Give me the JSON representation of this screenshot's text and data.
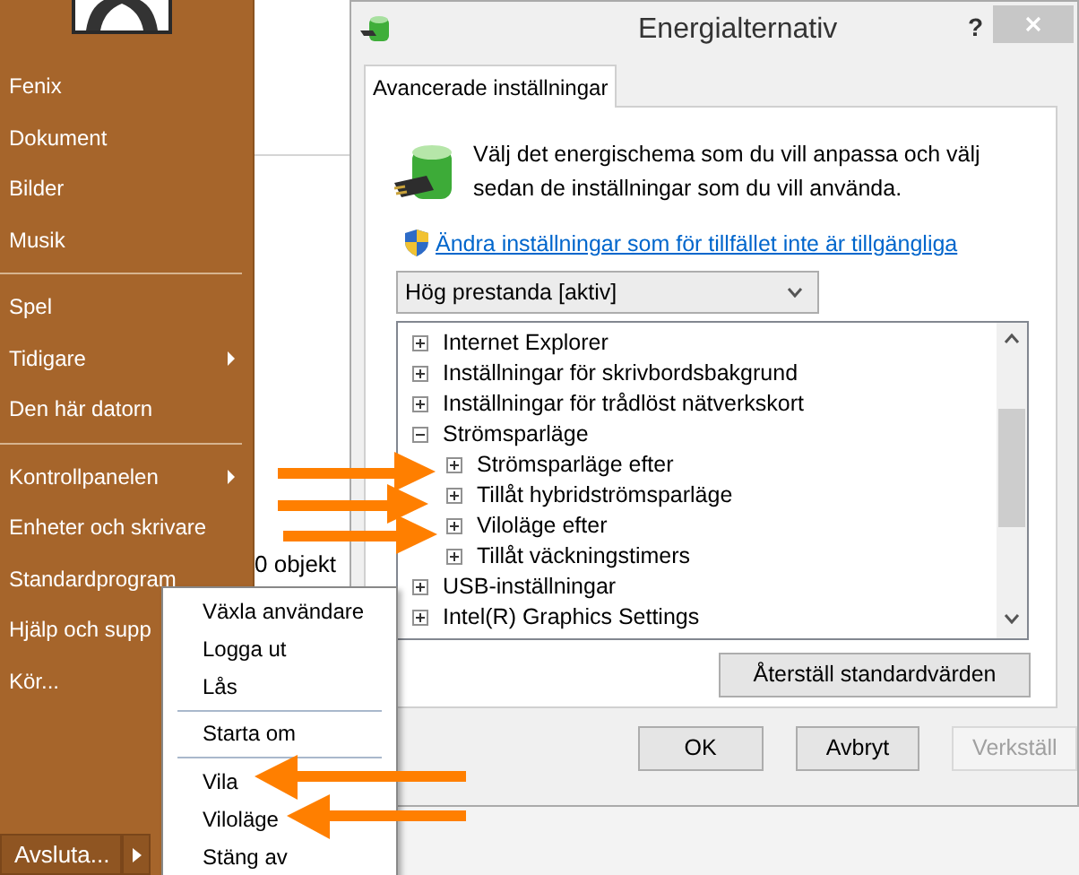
{
  "start_menu": {
    "groups": [
      [
        {
          "label": "Fenix",
          "submenu": false
        },
        {
          "label": "Dokument",
          "submenu": false
        },
        {
          "label": "Bilder",
          "submenu": false
        },
        {
          "label": "Musik",
          "submenu": false
        }
      ],
      [
        {
          "label": "Spel",
          "submenu": false
        },
        {
          "label": "Tidigare",
          "submenu": true
        },
        {
          "label": "Den här datorn",
          "submenu": false
        }
      ],
      [
        {
          "label": "Kontrollpanelen",
          "submenu": true
        },
        {
          "label": "Enheter och skrivare",
          "submenu": false
        },
        {
          "label": "Standardprogram",
          "submenu": false
        },
        {
          "label": "Hjälp och supp"
        },
        {
          "label": "Kör..."
        }
      ]
    ],
    "shutdown_button": "Avsluta..."
  },
  "power_menu": {
    "groups": [
      [
        "Växla användare",
        "Logga ut",
        "Lås"
      ],
      [
        "Starta om"
      ],
      [
        "Vila",
        "Viloläge",
        "Stäng av"
      ]
    ]
  },
  "background_window": {
    "status": "0 objekt"
  },
  "dialog": {
    "title": "Energialternativ",
    "help": "?",
    "tabs": [
      {
        "label": "Avancerade inställningar",
        "selected": true
      }
    ],
    "description": "Välj det energischema som du vill anpassa och välj sedan de inställningar som du vill använda.",
    "link": "Ändra inställningar som för tillfället inte är tillgängliga",
    "plan_select": {
      "value": "Hög prestanda [aktiv]"
    },
    "tree": [
      {
        "label": "Internet Explorer",
        "expanded": false
      },
      {
        "label": "Inställningar för skrivbordsbakgrund",
        "expanded": false
      },
      {
        "label": "Inställningar för trådlöst nätverkskort",
        "expanded": false
      },
      {
        "label": "Strömsparläge",
        "expanded": true,
        "children": [
          {
            "label": "Strömsparläge efter",
            "expanded": false
          },
          {
            "label": "Tillåt hybridströmsparläge",
            "expanded": false
          },
          {
            "label": "Viloläge efter",
            "expanded": false
          },
          {
            "label": "Tillåt väckningstimers",
            "expanded": false
          }
        ]
      },
      {
        "label": "USB-inställningar",
        "expanded": false
      },
      {
        "label": "Intel(R) Graphics Settings",
        "expanded": false
      }
    ],
    "restore_button": "Återställ standardvärden",
    "buttons": [
      {
        "label": "OK",
        "disabled": false
      },
      {
        "label": "Avbryt",
        "disabled": false
      },
      {
        "label": "Verkställ",
        "disabled": true
      }
    ]
  }
}
